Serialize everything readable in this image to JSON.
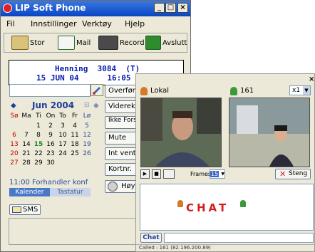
{
  "window": {
    "title": "LIP Soft Phone",
    "buttons": {
      "minimize": "_",
      "maximize": "□",
      "close": "×"
    }
  },
  "menu": [
    "Fil",
    "Innstillinger",
    "Verktøy",
    "Hjelp"
  ],
  "toolbar": [
    {
      "label": "Stor",
      "icon": "enlarge-icon"
    },
    {
      "label": "Mail",
      "icon": "mail-icon"
    },
    {
      "label": "Record",
      "icon": "tape-icon"
    },
    {
      "label": "Avslutt",
      "icon": "exit-icon"
    }
  ],
  "display": {
    "line1": "Henning  3084  (T)",
    "line2": "15 JUN 04      16:05"
  },
  "side_buttons": [
    "Overfør",
    "Viderek.",
    "Ikke Forstyrr",
    "Mute",
    "Int vent",
    "Kortnr.",
    "Høyttaler"
  ],
  "calendar": {
    "month_label": "Jun 2004",
    "day_names": [
      "Sø",
      "Ma",
      "Ti",
      "On",
      "To",
      "Fr",
      "Lø"
    ],
    "weeks": [
      [
        "",
        "",
        "1",
        "2",
        "3",
        "4",
        "5"
      ],
      [
        "6",
        "7",
        "8",
        "9",
        "10",
        "11",
        "12"
      ],
      [
        "13",
        "14",
        "15",
        "16",
        "17",
        "18",
        "19"
      ],
      [
        "20",
        "21",
        "22",
        "23",
        "24",
        "25",
        "26"
      ],
      [
        "27",
        "28",
        "29",
        "30",
        "",
        "",
        ""
      ]
    ],
    "today": "15"
  },
  "agenda": "11:00 Forhandler konf",
  "tabs": [
    "Kalender",
    "Tastatur"
  ],
  "sms_label": "SMS",
  "video": {
    "local_label": "Lokal",
    "remote_label": "161",
    "zoom": "x1",
    "frames_label": "Frames",
    "frames_value": "15",
    "stop_label": "Steng"
  },
  "chat": {
    "banner": "CHAT",
    "button_label": "Chat",
    "status": "Called : 161 (82.196.200.89)"
  },
  "colors": {
    "accent": "#0a45c4",
    "display_text": "#0a1ea8",
    "sunday_red": "#cc0000"
  }
}
